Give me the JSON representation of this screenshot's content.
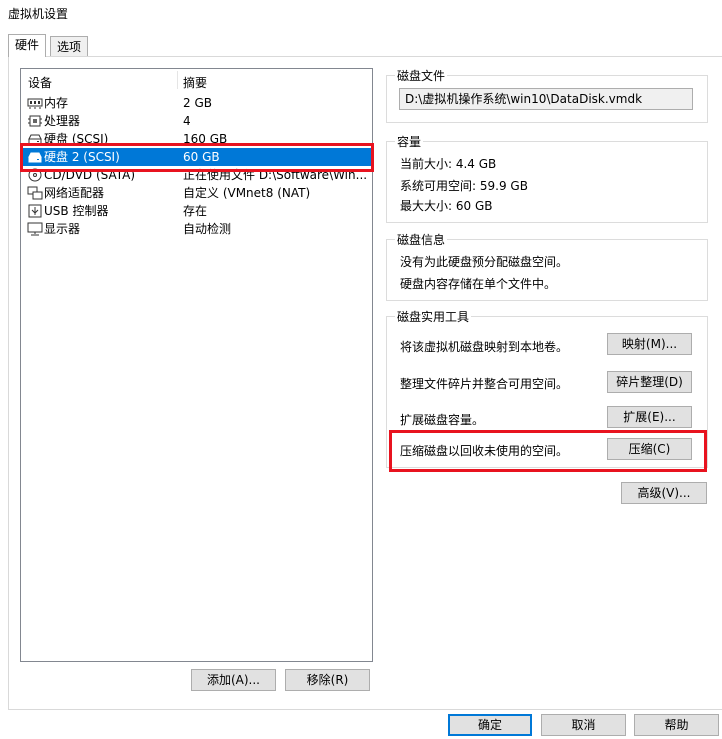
{
  "window": {
    "title": "虚拟机设置"
  },
  "tabs": [
    {
      "label": "硬件",
      "active": true
    },
    {
      "label": "选项",
      "active": false
    }
  ],
  "device_list": {
    "columns": [
      "设备",
      "摘要"
    ],
    "rows": [
      {
        "icon": "memory-icon",
        "name": "内存",
        "summary": "2 GB"
      },
      {
        "icon": "cpu-icon",
        "name": "处理器",
        "summary": "4"
      },
      {
        "icon": "hard-disk-icon",
        "name": "硬盘 (SCSI)",
        "summary": "160 GB"
      },
      {
        "icon": "hard-disk-icon",
        "name": "硬盘 2 (SCSI)",
        "summary": "60 GB",
        "selected": true
      },
      {
        "icon": "cd-dvd-icon",
        "name": "CD/DVD (SATA)",
        "summary": "正在使用文件 D:\\Software\\Win..."
      },
      {
        "icon": "network-adapter-icon",
        "name": "网络适配器",
        "summary": "自定义 (VMnet8 (NAT)"
      },
      {
        "icon": "usb-icon",
        "name": "USB 控制器",
        "summary": "存在"
      },
      {
        "icon": "display-icon",
        "name": "显示器",
        "summary": "自动检测"
      }
    ],
    "add_label": "添加(A)...",
    "remove_label": "移除(R)"
  },
  "disk_file": {
    "title": "磁盘文件",
    "path": "D:\\虚拟机操作系统\\win10\\DataDisk.vmdk"
  },
  "capacity": {
    "title": "容量",
    "current": "当前大小: 4.4 GB",
    "available": "系统可用空间: 59.9 GB",
    "max": "最大大小: 60 GB"
  },
  "disk_info": {
    "title": "磁盘信息",
    "line1": "没有为此硬盘预分配磁盘空间。",
    "line2": "硬盘内容存储在单个文件中。"
  },
  "utilities": {
    "title": "磁盘实用工具",
    "map_desc": "将该虚拟机磁盘映射到本地卷。",
    "map_label": "映射(M)...",
    "defrag_desc": "整理文件碎片并整合可用空间。",
    "defrag_label": "碎片整理(D)",
    "expand_desc": "扩展磁盘容量。",
    "expand_label": "扩展(E)...",
    "compact_desc": "压缩磁盘以回收未使用的空间。",
    "compact_label": "压缩(C)"
  },
  "advanced_label": "高级(V)...",
  "footer": {
    "ok_label": "确定",
    "cancel_label": "取消",
    "help_label": "帮助"
  },
  "colors": {
    "selection": "#0078d7",
    "annotation": "#e8131f"
  }
}
